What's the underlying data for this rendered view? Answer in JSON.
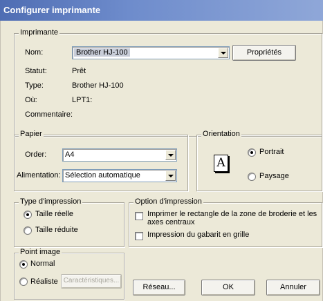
{
  "window": {
    "title": "Configurer imprimante"
  },
  "printer": {
    "legend": "Imprimante",
    "name_label": "Nom:",
    "name_value": "Brother HJ-100",
    "properties_button": "Propriétés",
    "status_label": "Statut:",
    "status_value": "Prêt",
    "type_label": "Type:",
    "type_value": "Brother HJ-100",
    "where_label": "Où:",
    "where_value": "LPT1:",
    "comment_label": "Commentaire:",
    "comment_value": ""
  },
  "paper": {
    "legend": "Papier",
    "order_label": "Order:",
    "order_value": "A4",
    "source_label": "Alimentation:",
    "source_value": "Sélection automatique"
  },
  "orientation": {
    "legend": "Orientation",
    "icon_letter": "A",
    "portrait_label": "Portrait",
    "landscape_label": "Paysage",
    "selected": "Portrait"
  },
  "print_type": {
    "legend": "Type d'impression",
    "real_size": "Taille réelle",
    "reduced_size": "Taille réduite",
    "selected": "Taille réelle"
  },
  "print_options": {
    "legend": "Option d'impression",
    "rectangle_line1": "Imprimer le rectangle de la zone de broderie et les",
    "rectangle_line2": "axes centraux",
    "rectangle_checked": false,
    "grid_label": "Impression du gabarit en grille",
    "grid_checked": false
  },
  "point_image": {
    "legend": "Point image",
    "normal": "Normal",
    "realistic": "Réaliste",
    "characteristics_button": "Caractéristiques...",
    "selected": "Normal"
  },
  "buttons": {
    "network": "Réseau...",
    "ok": "OK",
    "cancel": "Annuler"
  }
}
